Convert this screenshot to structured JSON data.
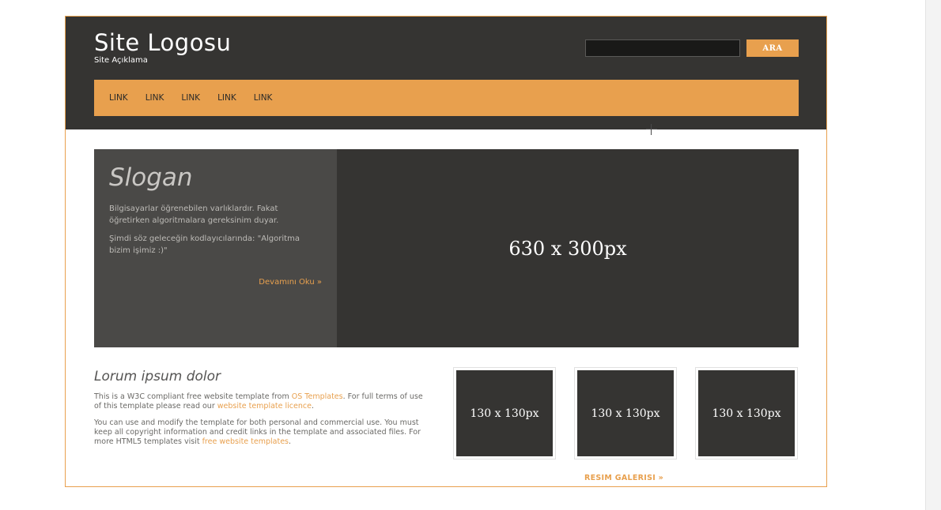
{
  "header": {
    "logo_title": "Site Logosu",
    "logo_description": "Site Açıklama",
    "search": {
      "placeholder": "",
      "value": "",
      "button_label": "ARA"
    }
  },
  "nav": {
    "links": [
      "LINK",
      "LINK",
      "LINK",
      "LINK",
      "LINK"
    ]
  },
  "featured": {
    "slogan_title": "Slogan",
    "paragraphs": [
      "Bilgisayarlar öğrenebilen varlıklardır. Fakat öğretirken algoritmalara gereksinim duyar.",
      "Şimdi söz geleceğin kodlayıcılarında: \"Algoritma bizim işimiz :)\""
    ],
    "read_more": "Devamını Oku »",
    "image_label": "630 x 300px"
  },
  "intro": {
    "heading": "Lorum ipsum dolor",
    "p1_a": "This is a W3C compliant free website template from ",
    "p1_link1": "OS Templates",
    "p1_b": ". For full terms of use of this template please read our ",
    "p1_link2": "website template licence",
    "p1_c": ".",
    "p2_a": "You can use and modify the template for both personal and commercial use. You must keep all copyright information and credit links in the template and associated files. For more HTML5 templates visit ",
    "p2_link": "free website templates",
    "p2_b": "."
  },
  "gallery": {
    "thumbnails": [
      "130 x 130px",
      "130 x 130px",
      "130 x 130px"
    ],
    "link_label": "RESIM GALERISI »"
  },
  "colors": {
    "accent": "#e8a04e",
    "header_bg": "#353432",
    "slogan_panel_bg": "#4a4947"
  }
}
